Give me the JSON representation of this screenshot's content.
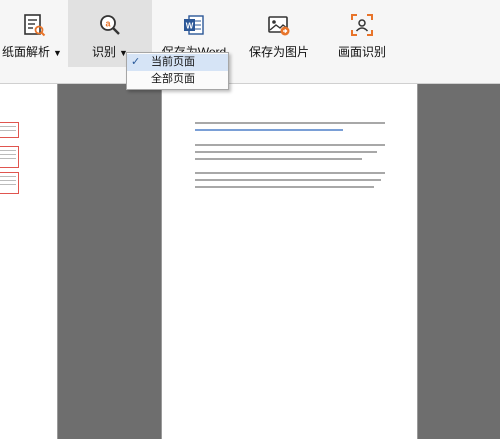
{
  "toolbar": {
    "items": [
      {
        "label": "纸面解析",
        "icon": "document-analysis-icon",
        "has_dropdown": true
      },
      {
        "label": "识别",
        "icon": "ocr-search-icon",
        "has_dropdown": true
      },
      {
        "label": "保存为Word",
        "icon": "word-icon"
      },
      {
        "label": "保存为图片",
        "icon": "save-image-icon"
      },
      {
        "label": "画面识别",
        "icon": "screen-capture-icon"
      }
    ],
    "caret": "▼"
  },
  "dropdown": {
    "items": [
      {
        "label": "当前页面",
        "checked": true,
        "check": "✓"
      },
      {
        "label": "全部页面",
        "checked": false
      }
    ]
  },
  "colors": {
    "accent": "#e8742a",
    "word_blue": "#2b5797",
    "orange": "#e8742a",
    "workspace": "#6e6e6e",
    "red_box": "#e0554f"
  }
}
